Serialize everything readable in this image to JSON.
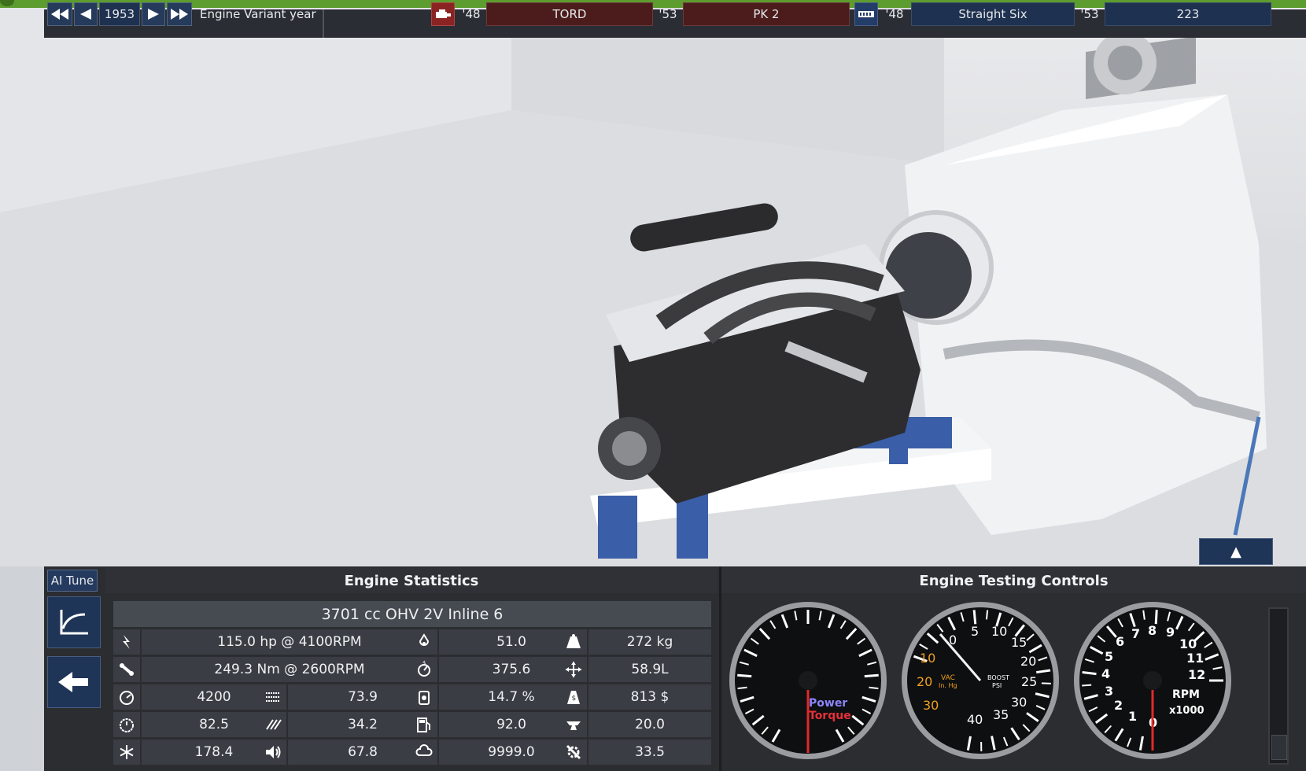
{
  "topbar": {
    "year": "1953",
    "year_label": "Engine Variant year",
    "family_start": "'48",
    "family_name": "TORD",
    "family_end": "'53",
    "variant_name": "PK 2",
    "layout_start": "'48",
    "layout_name": "Straight Six",
    "layout_end": "'53",
    "layout_variant": "223"
  },
  "panel": {
    "ai_tune": "AI Tune",
    "stats_title": "Engine Statistics",
    "controls_title": "Engine Testing Controls",
    "collapse_glyph": "▲"
  },
  "stats": {
    "summary": "3701 cc OHV 2V  Inline 6",
    "power": "115.0 hp @ 4100RPM",
    "torque": "249.3 Nm @ 2600RPM",
    "redline": "4200",
    "smoothness": "73.9",
    "reliability": "82.5",
    "responsiveness": "34.2",
    "cooling": "178.4",
    "noise": "67.8",
    "octane": "51.0",
    "fuel_econ": "375.6",
    "efficiency": "14.7 %",
    "fuel_quality": "92.0",
    "service": "9999.0",
    "weight": "272 kg",
    "size": "58.9L",
    "cost": "813 $",
    "production": "20.0",
    "eng_time": "33.5"
  },
  "gauges": {
    "power_label": "Power",
    "torque_label": "Torque",
    "boost_ticks": [
      "0",
      "5",
      "10",
      "15",
      "20",
      "25",
      "30",
      "35",
      "40"
    ],
    "vac_ticks": [
      "10",
      "20",
      "30"
    ],
    "vac_label1": "VAC",
    "vac_label2": "In. Hg",
    "boost_label1": "BOOST",
    "boost_label2": "PSI",
    "rpm_ticks": [
      "0",
      "1",
      "2",
      "3",
      "4",
      "5",
      "6",
      "7",
      "8",
      "9",
      "10",
      "11",
      "12"
    ],
    "rpm_label": "RPM",
    "rpm_unit": "x1000"
  },
  "colors": {
    "power": "#8b86ff",
    "torque": "#e8303a",
    "boost_orange": "#f0a020"
  }
}
